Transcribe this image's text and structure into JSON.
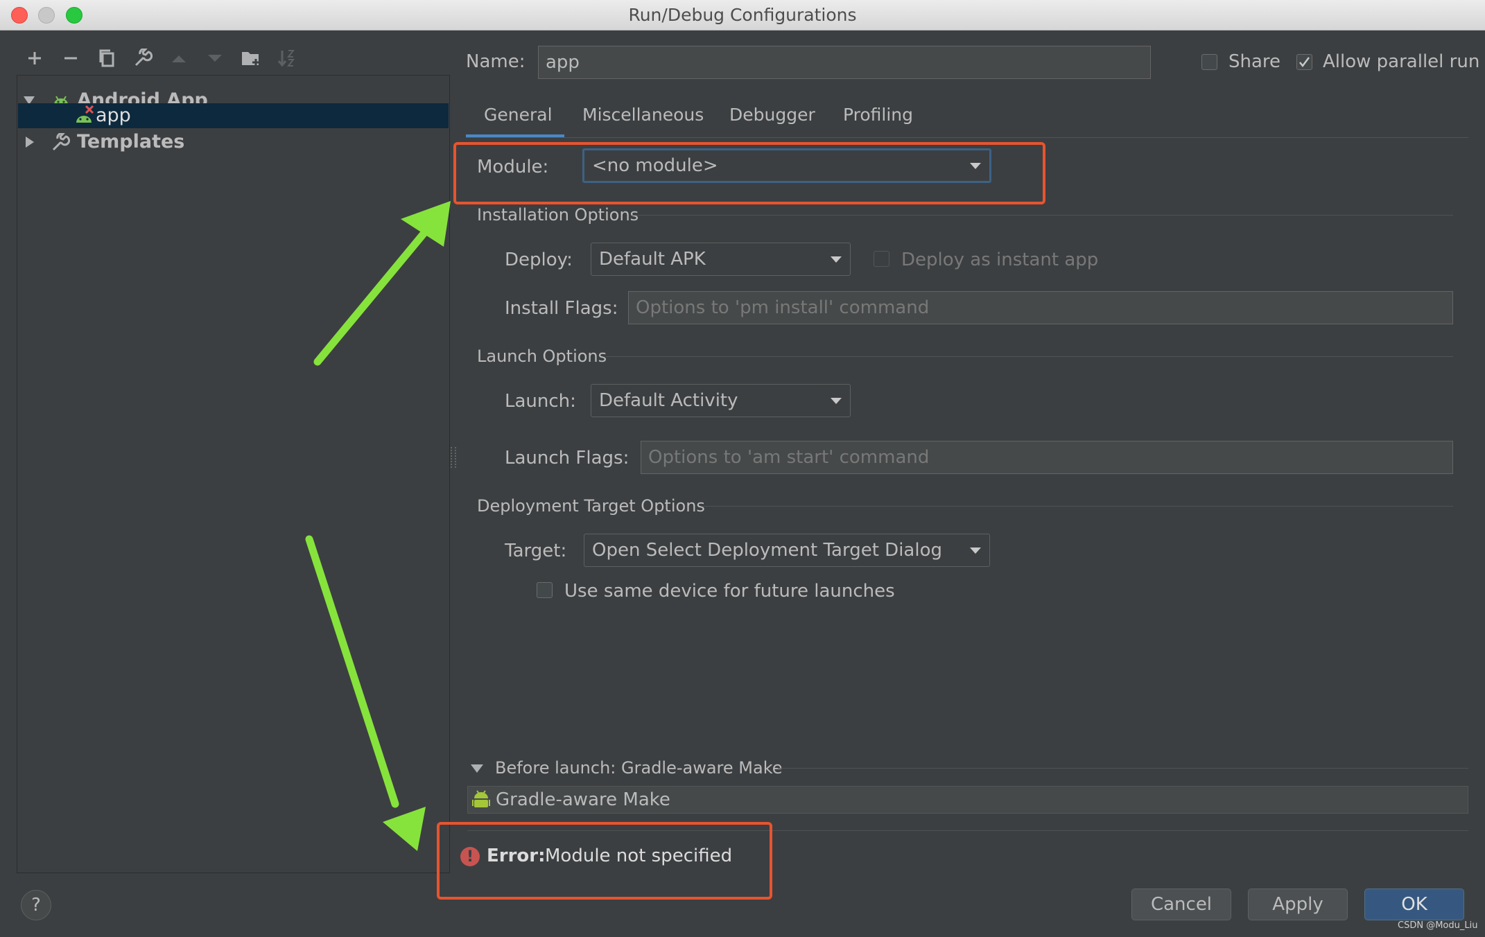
{
  "window": {
    "title": "Run/Debug Configurations"
  },
  "tree": {
    "group_label": "Android App",
    "item_label": "app",
    "templates_label": "Templates"
  },
  "header": {
    "name_label": "Name:",
    "name_value": "app",
    "share_label": "Share",
    "allow_parallel_label": "Allow parallel run"
  },
  "tabs": [
    {
      "label": "General"
    },
    {
      "label": "Miscellaneous"
    },
    {
      "label": "Debugger"
    },
    {
      "label": "Profiling"
    }
  ],
  "module": {
    "label": "Module:",
    "value": "<no module>"
  },
  "installation": {
    "section_title": "Installation Options",
    "deploy_label": "Deploy:",
    "deploy_value": "Default APK",
    "instant_label": "Deploy as instant app",
    "flags_label": "Install Flags:",
    "flags_placeholder": "Options to 'pm install' command"
  },
  "launch": {
    "section_title": "Launch Options",
    "launch_label": "Launch:",
    "launch_value": "Default Activity",
    "flags_label": "Launch Flags:",
    "flags_placeholder": "Options to 'am start' command"
  },
  "deployment_target": {
    "section_title": "Deployment Target Options",
    "target_label": "Target:",
    "target_value": "Open Select Deployment Target Dialog",
    "same_device_label": "Use same device for future launches"
  },
  "before_launch": {
    "header": "Before launch: Gradle-aware Make",
    "item": "Gradle-aware Make"
  },
  "error": {
    "prefix": "Error:",
    "message": "Module not specified"
  },
  "buttons": {
    "help": "?",
    "cancel": "Cancel",
    "apply": "Apply",
    "ok": "OK"
  },
  "watermark": "CSDN @Modu_Liu",
  "colors": {
    "accent": "#365880",
    "annotation_box": "#e8542f",
    "annotation_arrow": "#86e33c",
    "error_icon": "#c75450",
    "selection": "#0d293e"
  }
}
